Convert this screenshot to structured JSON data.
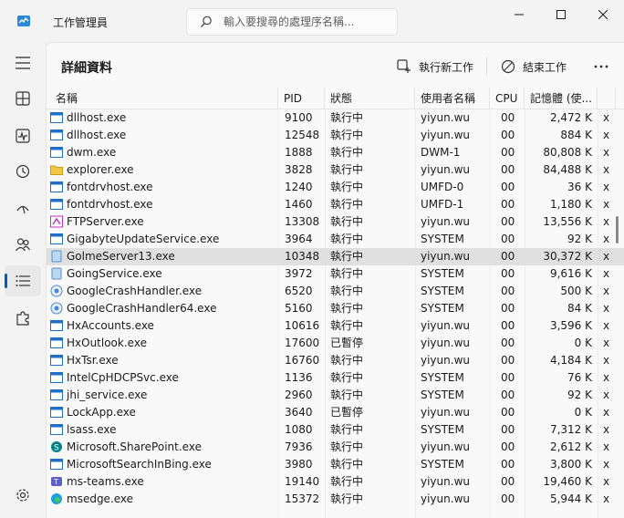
{
  "app": {
    "title": "工作管理員",
    "search_placeholder": "輸入要搜尋的處理序名稱..."
  },
  "toolbar": {
    "page_title": "詳細資料",
    "new_task": "執行新工作",
    "end_task": "結束工作"
  },
  "columns": {
    "name": "名稱",
    "pid": "PID",
    "status": "狀態",
    "user": "使用者名稱",
    "cpu": "CPU",
    "memory": "記憶體 (使..."
  },
  "rows": [
    {
      "name": "dllhost.exe",
      "pid": "9100",
      "status": "執行中",
      "user": "yiyun.wu",
      "cpu": "00",
      "mem": "2,472 K",
      "extra": "x",
      "icon": "window-icon"
    },
    {
      "name": "dllhost.exe",
      "pid": "12548",
      "status": "執行中",
      "user": "yiyun.wu",
      "cpu": "00",
      "mem": "884 K",
      "extra": "x",
      "icon": "window-icon"
    },
    {
      "name": "dwm.exe",
      "pid": "1888",
      "status": "執行中",
      "user": "DWM-1",
      "cpu": "00",
      "mem": "80,808 K",
      "extra": "x",
      "icon": "window-icon"
    },
    {
      "name": "explorer.exe",
      "pid": "3828",
      "status": "執行中",
      "user": "yiyun.wu",
      "cpu": "00",
      "mem": "84,488 K",
      "extra": "x",
      "icon": "folder-icon"
    },
    {
      "name": "fontdrvhost.exe",
      "pid": "1240",
      "status": "執行中",
      "user": "UMFD-0",
      "cpu": "00",
      "mem": "36 K",
      "extra": "x",
      "icon": "window-icon"
    },
    {
      "name": "fontdrvhost.exe",
      "pid": "1460",
      "status": "執行中",
      "user": "UMFD-1",
      "cpu": "00",
      "mem": "1,180 K",
      "extra": "x",
      "icon": "window-icon"
    },
    {
      "name": "FTPServer.exe",
      "pid": "13308",
      "status": "執行中",
      "user": "yiyun.wu",
      "cpu": "00",
      "mem": "13,556 K",
      "extra": "x",
      "icon": "ftp-icon"
    },
    {
      "name": "GigabyteUpdateService.exe",
      "pid": "3964",
      "status": "執行中",
      "user": "SYSTEM",
      "cpu": "00",
      "mem": "92 K",
      "extra": "x",
      "icon": "window-icon"
    },
    {
      "name": "GolmeServer13.exe",
      "pid": "10348",
      "status": "執行中",
      "user": "yiyun.wu",
      "cpu": "00",
      "mem": "30,372 K",
      "extra": "x",
      "icon": "app-icon",
      "selected": true
    },
    {
      "name": "GoingService.exe",
      "pid": "3972",
      "status": "執行中",
      "user": "SYSTEM",
      "cpu": "00",
      "mem": "9,616 K",
      "extra": "x",
      "icon": "app-icon"
    },
    {
      "name": "GoogleCrashHandler.exe",
      "pid": "6520",
      "status": "執行中",
      "user": "SYSTEM",
      "cpu": "00",
      "mem": "500 K",
      "extra": "x",
      "icon": "google-icon"
    },
    {
      "name": "GoogleCrashHandler64.exe",
      "pid": "5160",
      "status": "執行中",
      "user": "SYSTEM",
      "cpu": "00",
      "mem": "84 K",
      "extra": "x",
      "icon": "google-icon"
    },
    {
      "name": "HxAccounts.exe",
      "pid": "10616",
      "status": "執行中",
      "user": "yiyun.wu",
      "cpu": "00",
      "mem": "3,596 K",
      "extra": "x",
      "icon": "window-icon"
    },
    {
      "name": "HxOutlook.exe",
      "pid": "17600",
      "status": "已暫停",
      "user": "yiyun.wu",
      "cpu": "00",
      "mem": "0 K",
      "extra": "x",
      "icon": "window-icon"
    },
    {
      "name": "HxTsr.exe",
      "pid": "16760",
      "status": "執行中",
      "user": "yiyun.wu",
      "cpu": "00",
      "mem": "4,184 K",
      "extra": "x",
      "icon": "window-icon"
    },
    {
      "name": "IntelCpHDCPSvc.exe",
      "pid": "1136",
      "status": "執行中",
      "user": "SYSTEM",
      "cpu": "00",
      "mem": "76 K",
      "extra": "x",
      "icon": "window-icon"
    },
    {
      "name": "jhi_service.exe",
      "pid": "2960",
      "status": "執行中",
      "user": "SYSTEM",
      "cpu": "00",
      "mem": "92 K",
      "extra": "x",
      "icon": "window-icon"
    },
    {
      "name": "LockApp.exe",
      "pid": "3640",
      "status": "已暫停",
      "user": "yiyun.wu",
      "cpu": "00",
      "mem": "0 K",
      "extra": "x",
      "icon": "window-icon"
    },
    {
      "name": "lsass.exe",
      "pid": "1080",
      "status": "執行中",
      "user": "SYSTEM",
      "cpu": "00",
      "mem": "7,312 K",
      "extra": "x",
      "icon": "window-icon"
    },
    {
      "name": "Microsoft.SharePoint.exe",
      "pid": "7936",
      "status": "執行中",
      "user": "yiyun.wu",
      "cpu": "00",
      "mem": "2,612 K",
      "extra": "x",
      "icon": "sharepoint-icon"
    },
    {
      "name": "MicrosoftSearchInBing.exe",
      "pid": "3980",
      "status": "執行中",
      "user": "SYSTEM",
      "cpu": "00",
      "mem": "3,800 K",
      "extra": "x",
      "icon": "window-icon"
    },
    {
      "name": "ms-teams.exe",
      "pid": "19140",
      "status": "執行中",
      "user": "yiyun.wu",
      "cpu": "00",
      "mem": "19,460 K",
      "extra": "x",
      "icon": "teams-icon"
    },
    {
      "name": "msedge.exe",
      "pid": "15372",
      "status": "執行中",
      "user": "yiyun.wu",
      "cpu": "00",
      "mem": "5,944 K",
      "extra": "x",
      "icon": "edge-icon"
    }
  ],
  "colors": {
    "accent": "#005fb8",
    "selected_row": "#e0e0e0"
  }
}
